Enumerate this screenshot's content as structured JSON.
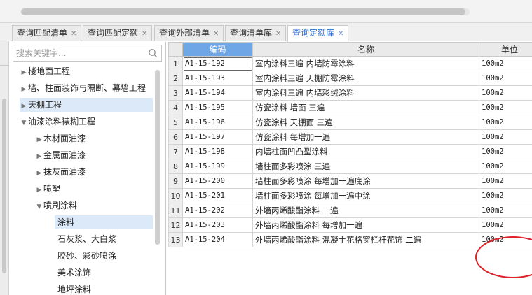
{
  "tabs": [
    {
      "label": "查询匹配清单",
      "active": false
    },
    {
      "label": "查询匹配定额",
      "active": false
    },
    {
      "label": "查询外部清单",
      "active": false
    },
    {
      "label": "查询清单库",
      "active": false
    },
    {
      "label": "查询定额库",
      "active": true
    }
  ],
  "search": {
    "placeholder": "搜索关键字..."
  },
  "tree": [
    {
      "label": "楼地面工程",
      "expander": "right"
    },
    {
      "label": "墙、柱面装饰与隔断、幕墙工程",
      "expander": "right"
    },
    {
      "label": "天棚工程",
      "expander": "right",
      "selected": true
    },
    {
      "label": "油漆涂料裱糊工程",
      "expander": "down"
    },
    {
      "label": "木材面油漆",
      "expander": "right"
    },
    {
      "label": "金属面油漆",
      "expander": "right"
    },
    {
      "label": "抹灰面油漆",
      "expander": "right"
    },
    {
      "label": "喷塑",
      "expander": "right"
    },
    {
      "label": "喷刷涂料",
      "expander": "down"
    },
    {
      "label": "涂料",
      "selected": true
    },
    {
      "label": "石灰浆、大白浆"
    },
    {
      "label": "胶砂、彩砂喷涂"
    },
    {
      "label": "美术涂饰"
    },
    {
      "label": "地坪涂料"
    }
  ],
  "table": {
    "headers": {
      "code": "编码",
      "name": "名称",
      "unit": "单位"
    },
    "rows": [
      {
        "num": "1",
        "code": "A1-15-192",
        "name": "室内涂料三遍 内墙防霉涂料",
        "unit": "100m2"
      },
      {
        "num": "2",
        "code": "A1-15-193",
        "name": "室内涂料三遍 天棚防霉涂料",
        "unit": "100m2"
      },
      {
        "num": "3",
        "code": "A1-15-194",
        "name": "室内涂料三遍 内墙彩绒涂料",
        "unit": "100m2"
      },
      {
        "num": "4",
        "code": "A1-15-195",
        "name": "仿瓷涂料 墙面 三遍",
        "unit": "100m2"
      },
      {
        "num": "5",
        "code": "A1-15-196",
        "name": "仿瓷涂料 天棚面 三遍",
        "unit": "100m2"
      },
      {
        "num": "6",
        "code": "A1-15-197",
        "name": "仿瓷涂料 每增加一遍",
        "unit": "100m2"
      },
      {
        "num": "7",
        "code": "A1-15-198",
        "name": "内墙柱面凹凸型涂料",
        "unit": "100m2"
      },
      {
        "num": "8",
        "code": "A1-15-199",
        "name": "墙柱面多彩喷涂 三遍",
        "unit": "100m2"
      },
      {
        "num": "9",
        "code": "A1-15-200",
        "name": "墙柱面多彩喷涂 每增加一遍底涂",
        "unit": "100m2"
      },
      {
        "num": "10",
        "code": "A1-15-201",
        "name": "墙柱面多彩喷涂 每增加一遍中涂",
        "unit": "100m2"
      },
      {
        "num": "11",
        "code": "A1-15-202",
        "name": "外墙丙烯酸酯涂料 二遍",
        "unit": "100m2"
      },
      {
        "num": "12",
        "code": "A1-15-203",
        "name": "外墙丙烯酸酯涂料 每增加一遍",
        "unit": "100m2"
      },
      {
        "num": "13",
        "code": "A1-15-204",
        "name": "外墙丙烯酸酯涂料 混凝土花格窗栏杆花饰 二遍",
        "unit": "100m2"
      }
    ]
  },
  "colors": {
    "accent": "#2a6fd6",
    "header_highlight": "#6ea6e6",
    "annotation": "#e0202a"
  },
  "icons": {
    "tab_close": "close-icon",
    "search": "search-icon",
    "tree_collapsed": "caret-right-icon",
    "tree_expanded": "caret-down-icon"
  }
}
